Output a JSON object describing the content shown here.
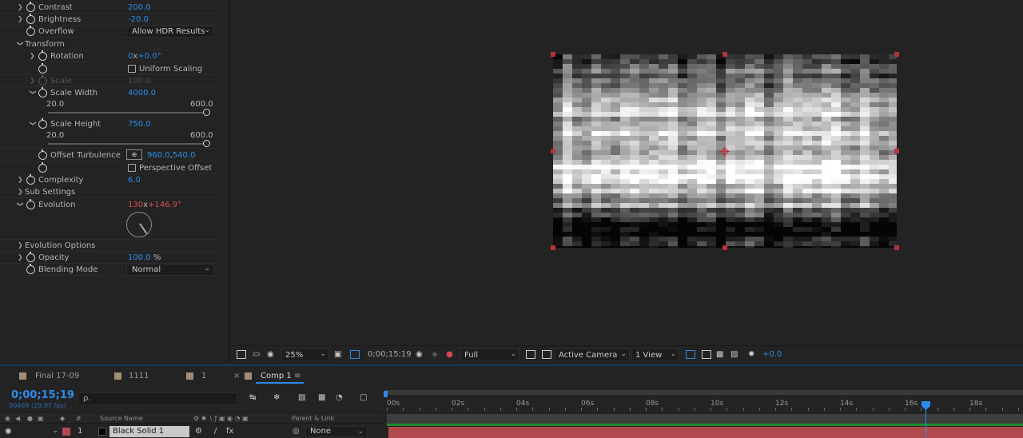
{
  "effects": {
    "contrast": {
      "label": "Contrast",
      "value": "200.0"
    },
    "brightness": {
      "label": "Brightness",
      "value": "-20.0"
    },
    "overflow": {
      "label": "Overflow",
      "value": "Allow HDR Results"
    },
    "transform": {
      "label": "Transform"
    },
    "rotation": {
      "label": "Rotation",
      "value_a": "0",
      "value_sep": "x",
      "value_b": "+0.0",
      "unit": "°"
    },
    "uniform_scaling": {
      "label": "Uniform Scaling",
      "checked": true
    },
    "scale": {
      "label": "Scale",
      "value": "100.0"
    },
    "scale_width": {
      "label": "Scale Width",
      "value": "4000.0",
      "min": "20.0",
      "max": "600.0",
      "fraction": 1.0
    },
    "scale_height": {
      "label": "Scale Height",
      "value": "750.0",
      "min": "20.0",
      "max": "600.0",
      "fraction": 1.0
    },
    "offset_turbulence": {
      "label": "Offset Turbulence",
      "value_x": "960.0",
      "value_sep": ",",
      "value_y": "540.0"
    },
    "perspective_offset": {
      "label": "Perspective Offset",
      "checked": false
    },
    "complexity": {
      "label": "Complexity",
      "value": "6.0"
    },
    "sub_settings": {
      "label": "Sub Settings"
    },
    "evolution": {
      "label": "Evolution",
      "value_a": "130",
      "value_sep": "x",
      "value_b": "+146.9",
      "unit": "°"
    },
    "evolution_options": {
      "label": "Evolution Options"
    },
    "opacity": {
      "label": "Opacity",
      "value": "100.0",
      "unit": " %"
    },
    "blending_mode": {
      "label": "Blending Mode",
      "value": "Normal"
    }
  },
  "viewer_toolbar": {
    "zoom": "25%",
    "timecode": "0;00;15;19",
    "resolution": "Full",
    "camera": "Active Camera",
    "views": "1 View",
    "exposure": "+0.0"
  },
  "timeline": {
    "tabs": [
      {
        "label": "Final 17-09"
      },
      {
        "label": "1111"
      },
      {
        "label": "1"
      },
      {
        "label": "Comp 1",
        "active": true
      }
    ],
    "close_glyph": "×",
    "menu_glyph": "≡",
    "current_time": "0;00;15;19",
    "frame_info": "00469 (29.97 fps)",
    "search_placeholder": "ρ.",
    "columns": {
      "hash": "#",
      "source_name": "Source Name",
      "parent_link": "Parent & Link"
    },
    "layer": {
      "index": "1",
      "name": "Black Solid 1",
      "parent": "None",
      "color": "#b04a4f",
      "fx": "fx"
    },
    "ruler_labels": [
      "00s",
      "02s",
      "04s",
      "06s",
      "08s",
      "10s",
      "12s",
      "14s",
      "16s",
      "18s"
    ],
    "playhead_seconds": 16.65
  },
  "colors": {
    "accent": "#2d8ceb",
    "keyframe_red": "#e04f4f",
    "layer_red": "#b04a4f",
    "handle_red": "#b3323a"
  }
}
